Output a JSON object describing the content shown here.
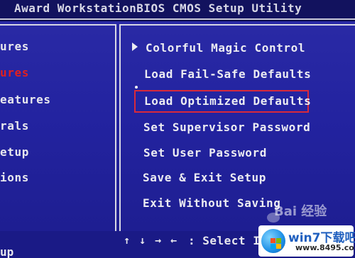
{
  "window": {
    "title": "Award WorkstationBIOS CMOS Setup Utility"
  },
  "left_menu": [
    {
      "label": "ures",
      "active": false
    },
    {
      "label": "ures",
      "active": true
    },
    {
      "label": "eatures",
      "active": false
    },
    {
      "label": "rals",
      "active": false
    },
    {
      "label": "etup",
      "active": false
    },
    {
      "label": "ions",
      "active": false
    }
  ],
  "right_menu": [
    {
      "label": "Colorful Magic Control",
      "has_submenu": true
    },
    {
      "label": "Load Fail-Safe Defaults",
      "has_submenu": false
    },
    {
      "label": "Load Optimized Defaults",
      "has_submenu": false,
      "highlighted": true
    },
    {
      "label": "Set Supervisor Password",
      "has_submenu": false
    },
    {
      "label": "Set User Password",
      "has_submenu": false
    },
    {
      "label": "Save & Exit Setup",
      "has_submenu": false
    },
    {
      "label": "Exit Without Saving",
      "has_submenu": false
    }
  ],
  "footer": {
    "left_hint": "up",
    "nav_keys": "↑ ↓ → ←",
    "select_hint": ": Select I"
  },
  "watermark": {
    "baidu_text": "Bai 经验",
    "site_name": "win7下载吧",
    "site_url": "www.8495.com"
  },
  "colors": {
    "background": "#2323a0",
    "text": "#e6e6ea",
    "active_left_item": "#e02020",
    "highlight_border": "#d92a3a",
    "title_bar": "#12125e"
  },
  "icons": {
    "submenu_arrow": "triangle-right-icon",
    "logo": "win7-logo-icon"
  }
}
